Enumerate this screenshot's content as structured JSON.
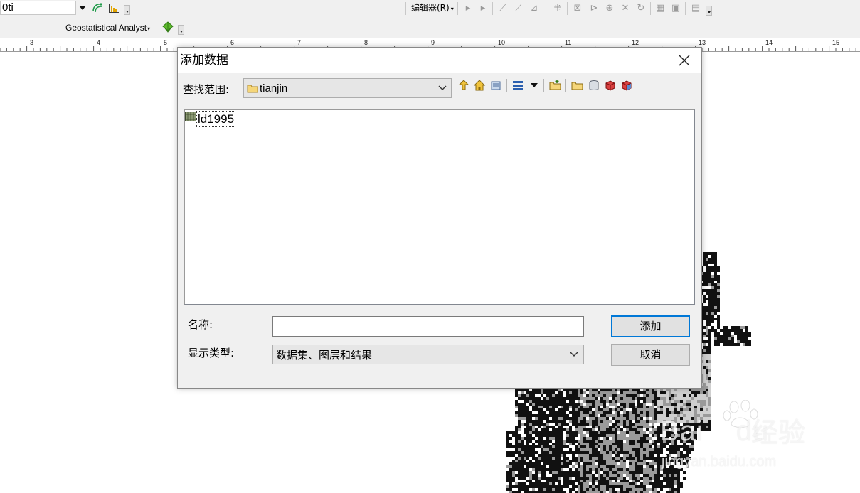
{
  "toolbar_top": {
    "layer_value": "0ti",
    "editor_menu": "编辑器(R)",
    "editor_menu_arrow": "▾"
  },
  "toolbar_second": {
    "geostat_menu": "Geostatistical Analyst",
    "geostat_arrow": "▾"
  },
  "ruler": {
    "labels": [
      "3",
      "4",
      "5",
      "6",
      "7",
      "8",
      "9",
      "10",
      "11",
      "12",
      "13",
      "14",
      "15"
    ]
  },
  "watermark": {
    "brand": "Bai",
    "brand2": "du",
    "jingyan": "经验",
    "url": "jingyan.baidu.com"
  },
  "dialog": {
    "title": "添加数据",
    "look_in_label": "查找范围:",
    "look_in_value": "tianjin",
    "files": [
      {
        "name": "ld1995",
        "icon": "raster-dataset-icon"
      }
    ],
    "name_label": "名称:",
    "name_value": "",
    "type_label": "显示类型:",
    "type_value": "数据集、图层和结果",
    "add_label": "添加",
    "cancel_label": "取消"
  },
  "colors": {
    "accent": "#0078d7",
    "toolbar_bg": "#f0f0f0",
    "dialog_bg": "#f0f0f0",
    "map_dark": "#111111",
    "map_mid": "#9a9a9a",
    "map_light": "#cfcfcf"
  }
}
